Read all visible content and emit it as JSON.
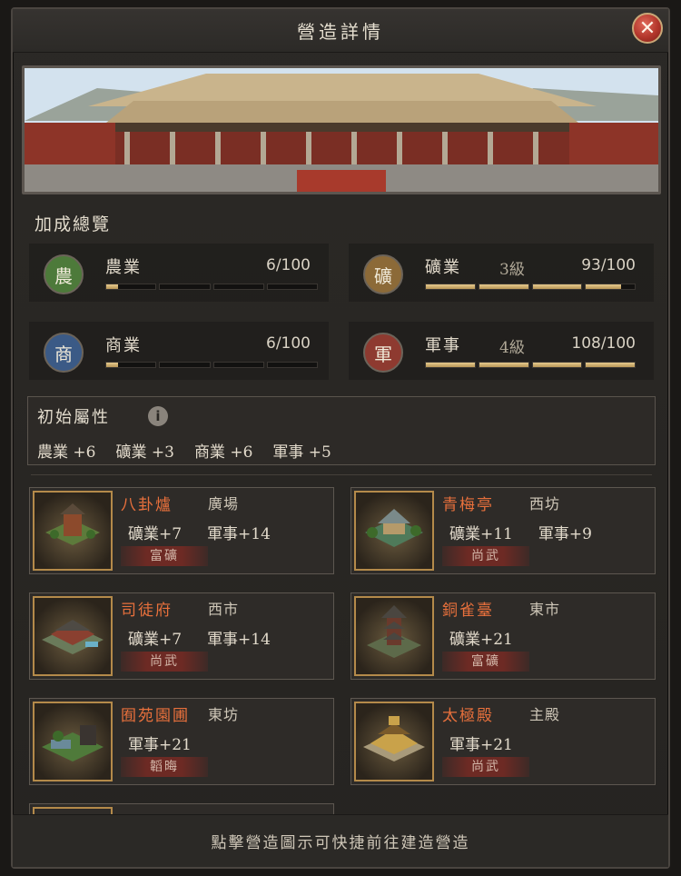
{
  "window": {
    "title": "營造詳情",
    "close_glyph": "✕"
  },
  "bonus": {
    "title": "加成總覽",
    "stats": [
      {
        "badge": "農",
        "name": "農業",
        "level": "",
        "value": "6/100",
        "progress": 0.06,
        "color": "#4d7a3a"
      },
      {
        "badge": "礦",
        "name": "礦業",
        "level": "3級",
        "value": "93/100",
        "progress": 0.93,
        "color": "#8c6a38"
      },
      {
        "badge": "商",
        "name": "商業",
        "level": "",
        "value": "6/100",
        "progress": 0.06,
        "color": "#3b5a86"
      },
      {
        "badge": "軍",
        "name": "軍事",
        "level": "4級",
        "value": "108/100",
        "progress": 1.0,
        "color": "#8e3a30"
      }
    ]
  },
  "initial": {
    "title": "初始屬性",
    "info_icon": "i",
    "items": [
      "農業 +6",
      "礦業 +3",
      "商業 +6",
      "軍事 +5"
    ]
  },
  "buildings": [
    {
      "name": "八卦爐",
      "location": "廣場",
      "stats": [
        "礦業+7",
        "軍事+14"
      ],
      "tag": "富礦",
      "icon": "furnace-building-icon"
    },
    {
      "name": "青梅亭",
      "location": "西坊",
      "stats": [
        "礦業+11",
        "軍事+9"
      ],
      "tag": "尚武",
      "icon": "pavilion-building-icon"
    },
    {
      "name": "司徒府",
      "location": "西市",
      "stats": [
        "礦業+7",
        "軍事+14"
      ],
      "tag": "尚武",
      "icon": "mansion-building-icon"
    },
    {
      "name": "銅雀臺",
      "location": "東市",
      "stats": [
        "礦業+21"
      ],
      "tag": "富礦",
      "icon": "tower-building-icon"
    },
    {
      "name": "囿苑園圃",
      "location": "東坊",
      "stats": [
        "軍事+21"
      ],
      "tag": "韜晦",
      "icon": "garden-building-icon"
    },
    {
      "name": "太極殿",
      "location": "主殿",
      "stats": [
        "軍事+21"
      ],
      "tag": "尚武",
      "icon": "palace-building-icon"
    }
  ],
  "footer": {
    "hint": "點擊營造圖示可快捷前往建造營造"
  }
}
